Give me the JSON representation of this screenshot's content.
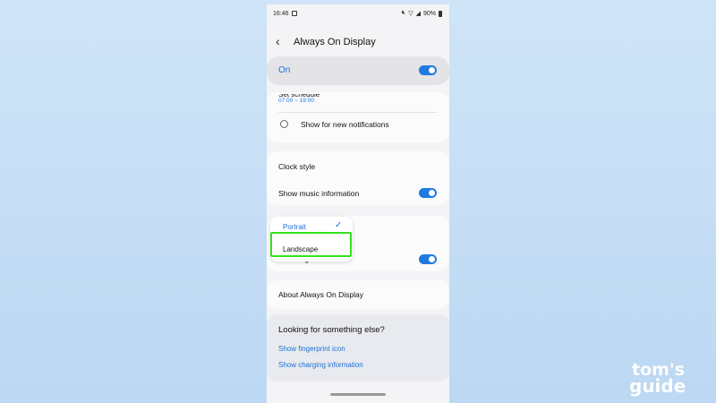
{
  "status_bar": {
    "time": "16:46",
    "battery": "90%"
  },
  "header": {
    "title": "Always On Display"
  },
  "master_toggle": {
    "label": "On",
    "state": true
  },
  "schedule_card": {
    "set_schedule_label": "Set schedule",
    "schedule_time": "07:00 ~ 19:00",
    "notifications_label": "Show for new notifications"
  },
  "display_card": {
    "clock_style_label": "Clock style",
    "music_info_label": "Show music information",
    "music_info_state": true
  },
  "orientation_card": {
    "auto_brightness_label": "Auto brightness",
    "auto_brightness_state": true
  },
  "orientation_dropdown": {
    "options": [
      "Portrait",
      "Landscape"
    ],
    "selected": "Portrait"
  },
  "about": {
    "label": "About Always On Display"
  },
  "looking_for": {
    "title": "Looking for something else?",
    "links": [
      "Show fingerprint icon",
      "Show charging information"
    ]
  },
  "watermark": {
    "line1": "tom's",
    "line2": "guide"
  },
  "colors": {
    "accent": "#1e70d6",
    "highlight": "#33e21a"
  }
}
